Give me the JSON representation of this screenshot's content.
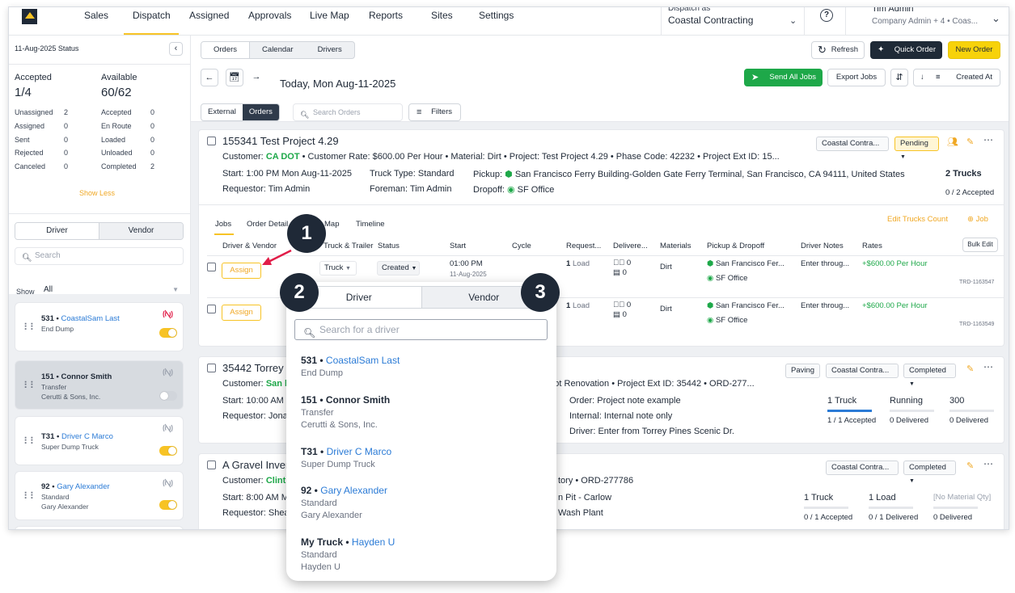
{
  "nav": {
    "items": [
      "Sales",
      "Dispatch",
      "Assigned",
      "Approvals",
      "Live Map",
      "Reports",
      "Sites",
      "Settings"
    ],
    "dispatch_as_label": "Dispatch as",
    "dispatch_as_value": "Coastal Contracting",
    "user_name": "Tim Admin",
    "user_role": "Company Admin + 4 • Coas..."
  },
  "sidebar": {
    "status_title": "11-Aug-2025 Status",
    "accepted_label": "Accepted",
    "accepted_value": "1/4",
    "available_label": "Available",
    "available_value": "60/62",
    "left_stats": [
      {
        "label": "Unassigned",
        "value": "2"
      },
      {
        "label": "Assigned",
        "value": "0"
      },
      {
        "label": "Sent",
        "value": "0"
      },
      {
        "label": "Rejected",
        "value": "0"
      },
      {
        "label": "Canceled",
        "value": "0"
      }
    ],
    "right_stats": [
      {
        "label": "Accepted",
        "value": "0"
      },
      {
        "label": "En Route",
        "value": "0"
      },
      {
        "label": "Loaded",
        "value": "0"
      },
      {
        "label": "Unloaded",
        "value": "0"
      },
      {
        "label": "Completed",
        "value": "2"
      }
    ],
    "show_less": "Show Less",
    "tab_driver": "Driver",
    "tab_vendor": "Vendor",
    "search_placeholder": "Search",
    "show_label": "Show",
    "show_value": "All",
    "drivers": [
      {
        "num": "531 •",
        "name": "CoastalSam Last",
        "line2": "End Dump",
        "line3": "",
        "toggle": "on",
        "signal": "red"
      },
      {
        "num": "151 • Connor Smith",
        "name": "",
        "line2": "Transfer",
        "line3": "Cerutti & Sons, Inc.",
        "toggle": "off",
        "signal": "gray"
      },
      {
        "num": "T31 •",
        "name": "Driver C Marco",
        "line2": "Super Dump Truck",
        "line3": "",
        "toggle": "on",
        "signal": "gray"
      },
      {
        "num": "92 •",
        "name": "Gary Alexander",
        "line2": "Standard",
        "line3": "Gary Alexander",
        "toggle": "on",
        "signal": "gray"
      }
    ]
  },
  "toolbar": {
    "view_tabs": [
      "Orders",
      "Calendar",
      "Drivers"
    ],
    "refresh": "Refresh",
    "quick_order": "Quick Order",
    "new_order": "New Order",
    "date_title": "Today, Mon Aug-11-2025",
    "send_all": "Send All Jobs",
    "export": "Export Jobs",
    "sort": "Created At",
    "filter_tabs": [
      "External",
      "Orders"
    ],
    "search_placeholder": "Search Orders",
    "filters": "Filters"
  },
  "order1": {
    "title": "155341 Test Project 4.29",
    "customer_label": "Customer:",
    "customer": "CA DOT",
    "details": "• Customer Rate: $600.00 Per Hour • Material: Dirt • Project: Test Project 4.29 • Phase Code: 42232 • Project Ext ID: 15...",
    "company_tag": "Coastal Contra...",
    "status": "Pending",
    "start": "Start: 1:00 PM Mon Aug-11-2025",
    "truck_type": "Truck Type: Standard",
    "pickup_label": "Pickup:",
    "pickup": "San Francisco Ferry Building-Golden Gate Ferry Terminal, San Francisco, CA 94111, United States",
    "requestor": "Requestor: Tim Admin",
    "foreman": "Foreman: Tim Admin",
    "dropoff_label": "Dropoff:",
    "dropoff": "SF Office",
    "trucks": "2 Trucks",
    "accepted": "0 / 2 Accepted",
    "tabs": [
      "Jobs",
      "Order Detail",
      "Map",
      "Timeline"
    ],
    "edit_trucks": "Edit Trucks Count",
    "add_job": "Job",
    "columns": [
      "Driver & Vendor",
      "Truck & Trailer",
      "Status",
      "Start",
      "Cycle",
      "Request...",
      "Delivere...",
      "Materials",
      "Pickup & Dropoff",
      "Driver Notes",
      "Rates"
    ],
    "bulk_edit": "Bulk Edit",
    "jobs": [
      {
        "assign": "Assign",
        "truck": "Truck",
        "status": "Created",
        "start": "01:00 PM",
        "start2": "11-Aug-2025",
        "request": "1",
        "request_unit": "Load",
        "delivered_a": "0",
        "delivered_b": "0",
        "material": "Dirt",
        "pickup": "San Francisco Fer...",
        "dropoff": "SF Office",
        "notes": "Enter throug...",
        "rate": "+$600.00 Per Hour",
        "id": "TRD-1163547"
      },
      {
        "assign": "Assign",
        "request": "1",
        "request_unit": "Load",
        "delivered_a": "0",
        "delivered_b": "0",
        "material": "Dirt",
        "pickup": "San Francisco Fer...",
        "dropoff": "SF Office",
        "notes": "Enter throug...",
        "rate": "+$600.00 Per Hour",
        "id": "TRD-1163549"
      }
    ]
  },
  "order2": {
    "title": "35442 Torrey",
    "customer_label": "Customer:",
    "customer": "San l",
    "details_right": "g Lot Renovation • Project Ext ID: 35442 • ORD-277...",
    "tag": "Paving",
    "company_tag": "Coastal Contra...",
    "status": "Completed",
    "start": "Start: 10:00 AM",
    "requestor": "Requestor: Jona",
    "order_note_label": "Order:",
    "order_note": "Project note example",
    "internal_label": "Internal:",
    "internal_note": "Internal note only",
    "driver_label": "Driver:",
    "driver_note": "Enter from Torrey Pines Scenic Dr.",
    "stat1": "1 Truck",
    "stat1_sub": "1 / 1 Accepted",
    "stat2": "Running",
    "stat2_sub": "0 Delivered",
    "stat3": "300",
    "stat3_sub": "0 Delivered"
  },
  "order3": {
    "title": "A Gravel Inver",
    "customer_label": "Customer:",
    "customer": "Clint",
    "details_right": "tory • ORD-277786",
    "company_tag": "Coastal Contra...",
    "status": "Completed",
    "start": "Start: 8:00 AM M",
    "requestor": "Requestor: Shea",
    "pickup_right": "n Pit - Carlow",
    "dropoff_right": "Wash Plant",
    "stat1": "1 Truck",
    "stat1_sub": "0 / 1 Accepted",
    "stat2": "1 Load",
    "stat2_sub": "0 / 1 Delivered",
    "stat3": "[No Material Qty]",
    "stat3_sub": "0 Delivered"
  },
  "popover": {
    "tab_driver": "Driver",
    "tab_vendor": "Vendor",
    "search_placeholder": "Search for a driver",
    "items": [
      {
        "num": "531 •",
        "name": "CoastalSam Last",
        "line2": "End Dump",
        "line3": ""
      },
      {
        "num": "151 • Connor Smith",
        "name": "",
        "line2": "Transfer",
        "line3": "Cerutti & Sons, Inc."
      },
      {
        "num": "T31 •",
        "name": "Driver C Marco",
        "line2": "Super Dump Truck",
        "line3": ""
      },
      {
        "num": "92 •",
        "name": "Gary Alexander",
        "line2": "Standard",
        "line3": "Gary Alexander"
      },
      {
        "num": "My Truck •",
        "name": "Hayden U",
        "line2": "Standard",
        "line3": "Hayden U"
      }
    ]
  },
  "callouts": [
    "1",
    "2",
    "3"
  ],
  "colors": {
    "accent": "#f7c325",
    "green": "#1ea849",
    "link_blue": "#2b7bd6",
    "dark": "#1f2937"
  }
}
